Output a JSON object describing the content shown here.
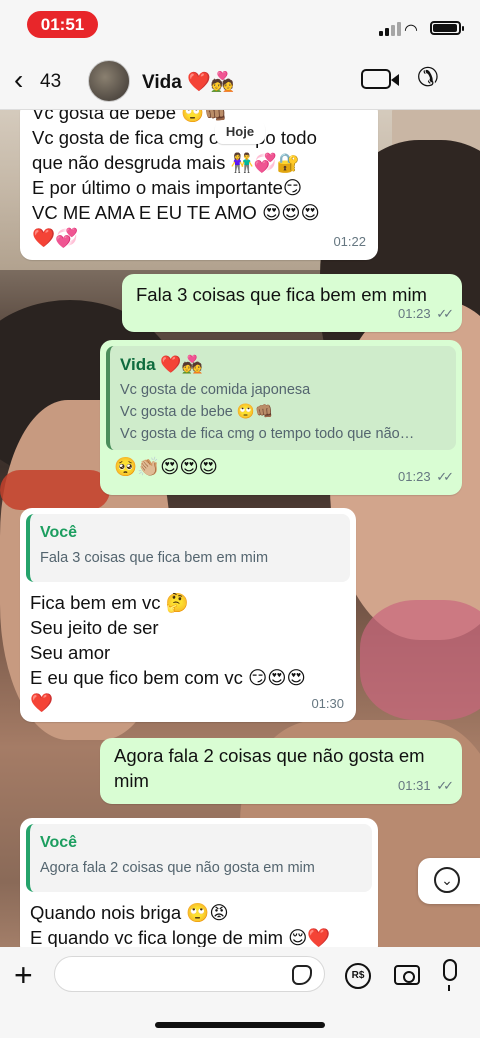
{
  "status": {
    "time": "01:51"
  },
  "header": {
    "back_count": "43",
    "contact_name": "Vida ❤️💑"
  },
  "date_chip": "Hoje",
  "messages": [
    {
      "dir": "in",
      "lines": [
        "Vc gosta de bebe 🙄👊🏽",
        "Vc gosta de fica cmg o tempo todo",
        "que não desgruda mais 👫💞🔐",
        "E por último o mais importante😏",
        "VC ME AMA E EU TE AMO 😍😍😍",
        "❤️💞"
      ],
      "time": "01:22"
    },
    {
      "dir": "out",
      "text": "Fala 3 coisas que fica bem em mim",
      "time": "01:23"
    },
    {
      "dir": "out",
      "quote_author": "Vida ❤️💑",
      "quote_lines": [
        "Vc gosta de comida japonesa",
        "Vc gosta de bebe 🙄👊🏽",
        "Vc gosta de fica cmg o tempo todo que não…"
      ],
      "text": "🥺👏🏼😍😍😍",
      "time": "01:23"
    },
    {
      "dir": "in",
      "quote_author": "Você",
      "quote_text": "Fala 3 coisas que fica bem em mim",
      "lines": [
        "Fica bem em vc 🤔",
        "Seu jeito de ser",
        "Seu amor",
        "E eu que fico bem com vc 😏😍😍",
        "❤️"
      ],
      "time": "01:30"
    },
    {
      "dir": "out",
      "lines": [
        "Agora fala 2 coisas que não gosta em",
        "mim"
      ],
      "time": "01:31"
    },
    {
      "dir": "in",
      "quote_author": "Você",
      "quote_text": "Agora fala 2 coisas que não gosta em mim",
      "lines": [
        "Quando nois briga 🙄😡",
        "E quando vc fica longe de mim 😌❤️"
      ]
    }
  ],
  "input": {
    "placeholder": "",
    "money_icon_text": "R$"
  },
  "icons": [
    "back-chevron-icon",
    "video-call-icon",
    "phone-icon",
    "scroll-down-icon",
    "plus-icon",
    "sticker-icon",
    "payment-icon",
    "camera-icon",
    "microphone-icon"
  ]
}
